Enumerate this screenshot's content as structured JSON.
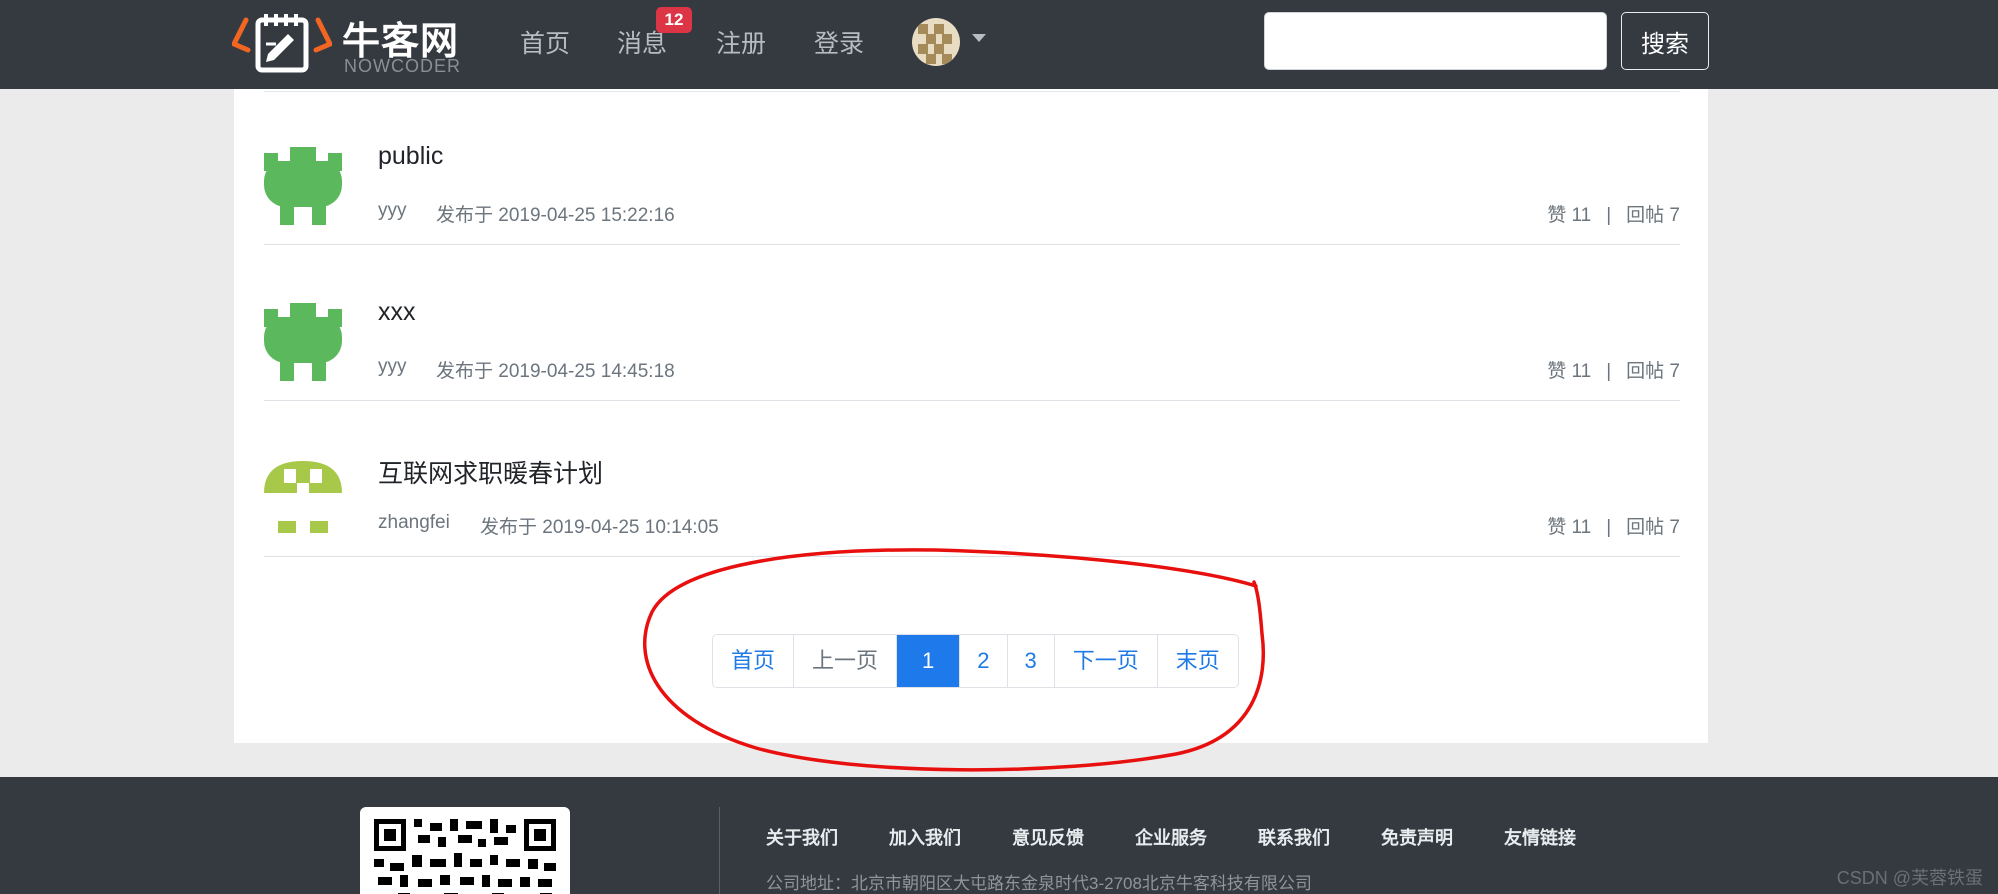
{
  "header": {
    "logo_cn": "牛客网",
    "logo_en": "NOWCODER",
    "nav": {
      "home": "首页",
      "messages": "消息",
      "messages_badge": "12",
      "register": "注册",
      "login": "登录"
    },
    "search": {
      "value": "",
      "placeholder": "",
      "button": "搜索"
    }
  },
  "posts": [
    {
      "title": "public",
      "author": "yyy",
      "time": "发布于 2019-04-25 15:22:16",
      "likes": "赞 11",
      "sep": "|",
      "replies": "回帖 7",
      "avatar_color": "#5cb85c"
    },
    {
      "title": "xxx",
      "author": "yyy",
      "time": "发布于 2019-04-25 14:45:18",
      "likes": "赞 11",
      "sep": "|",
      "replies": "回帖 7",
      "avatar_color": "#5cb85c"
    },
    {
      "title": "互联网求职暖春计划",
      "author": "zhangfei",
      "time": "发布于 2019-04-25 10:14:05",
      "likes": "赞 11",
      "sep": "|",
      "replies": "回帖 7",
      "avatar_color": "#a8c84a"
    }
  ],
  "pagination": {
    "first": "首页",
    "prev": "上一页",
    "pages": [
      "1",
      "2",
      "3"
    ],
    "active_page": "1",
    "next": "下一页",
    "last": "末页"
  },
  "footer": {
    "links": [
      "关于我们",
      "加入我们",
      "意见反馈",
      "企业服务",
      "联系我们",
      "免责声明",
      "友情链接"
    ],
    "address": "公司地址：北京市朝阳区大屯路东金泉时代3-2708北京牛客科技有限公司"
  },
  "watermark": "CSDN @芙蓉铁蛋",
  "colors": {
    "header_bg": "#343a40",
    "accent": "#1e7aeb",
    "badge": "#dc3545",
    "annotation": "#e8100e"
  }
}
